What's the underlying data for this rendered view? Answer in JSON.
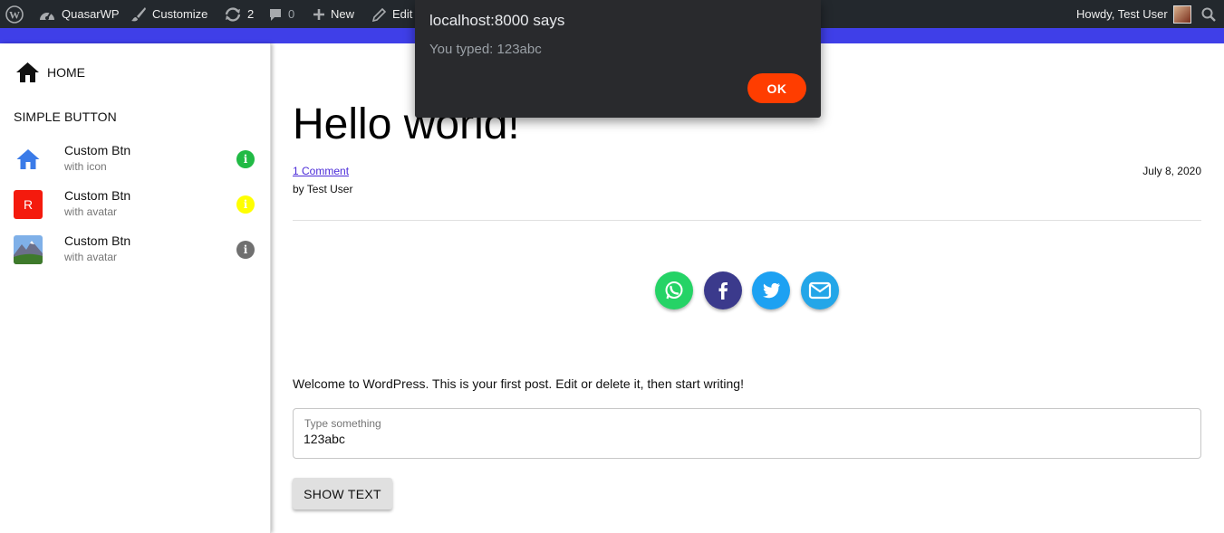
{
  "adminbar": {
    "site_name": "QuasarWP",
    "customize": "Customize",
    "updates_count": "2",
    "comments_count": "0",
    "new_label": "New",
    "edit_label": "Edit",
    "howdy": "Howdy, Test User"
  },
  "sidebar": {
    "home": "HOME",
    "section": "SIMPLE BUTTON",
    "items": [
      {
        "title": "Custom Btn",
        "subtitle": "with icon",
        "info_color": "#21ba45"
      },
      {
        "title": "Custom Btn",
        "subtitle": "with avatar",
        "avatar_letter": "R",
        "info_color": "#ffff00"
      },
      {
        "title": "Custom Btn",
        "subtitle": "with avatar",
        "info_color": "#707070"
      }
    ]
  },
  "post": {
    "title": "Hello world!",
    "comment_link": "1 Comment",
    "date": "July 8, 2020",
    "byline": "by Test User",
    "body": "Welcome to WordPress. This is your first post. Edit or delete it, then start writing!"
  },
  "share": {
    "icons": [
      "whatsapp-icon",
      "facebook-icon",
      "twitter-icon",
      "email-icon"
    ],
    "colors": [
      "#25d366",
      "#3b3a8c",
      "#1da1f2",
      "#24a6e8"
    ]
  },
  "form": {
    "label": "Type something",
    "value": "123abc",
    "button": "SHOW TEXT"
  },
  "dialog": {
    "title": "localhost:8000 says",
    "message": "You typed: 123abc",
    "ok": "OK"
  },
  "colors": {
    "adminbar_bg": "#23282d",
    "header_blue": "#3f3fe8",
    "dialog_ok": "#ff3d00"
  }
}
